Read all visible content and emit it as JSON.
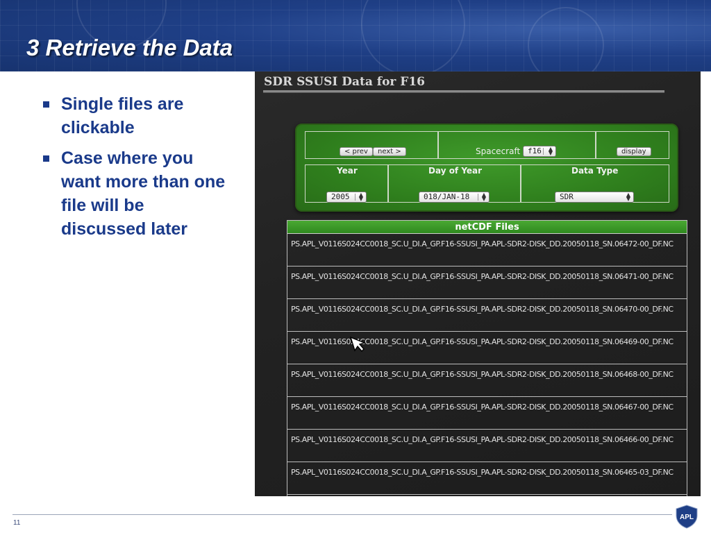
{
  "slide": {
    "title": "3 Retrieve the Data",
    "bullets": [
      "Single files are clickable",
      "Case where you want more than one file will be discussed later"
    ],
    "page_number": "11",
    "logo_text": "APL"
  },
  "app": {
    "title": "SDR SSUSI Data for F16",
    "controls": {
      "prev_label": "< prev",
      "next_label": "next >",
      "spacecraft_label": "Spacecraft",
      "spacecraft_value": "f16",
      "display_label": "display",
      "year_header": "Year",
      "doy_header": "Day of Year",
      "datatype_header": "Data Type",
      "year_value": "2005",
      "doy_value": "018/JAN-18",
      "datatype_value": "SDR"
    },
    "files": {
      "header": "netCDF Files",
      "items": [
        "PS.APL_V0116S024CC0018_SC.U_DI.A_GP.F16-SSUSI_PA.APL-SDR2-DISK_DD.20050118_SN.06472-00_DF.NC",
        "PS.APL_V0116S024CC0018_SC.U_DI.A_GP.F16-SSUSI_PA.APL-SDR2-DISK_DD.20050118_SN.06471-00_DF.NC",
        "PS.APL_V0116S024CC0018_SC.U_DI.A_GP.F16-SSUSI_PA.APL-SDR2-DISK_DD.20050118_SN.06470-00_DF.NC",
        "PS.APL_V0116S024CC0018_SC.U_DI.A_GP.F16-SSUSI_PA.APL-SDR2-DISK_DD.20050118_SN.06469-00_DF.NC",
        "PS.APL_V0116S024CC0018_SC.U_DI.A_GP.F16-SSUSI_PA.APL-SDR2-DISK_DD.20050118_SN.06468-00_DF.NC",
        "PS.APL_V0116S024CC0018_SC.U_DI.A_GP.F16-SSUSI_PA.APL-SDR2-DISK_DD.20050118_SN.06467-00_DF.NC",
        "PS.APL_V0116S024CC0018_SC.U_DI.A_GP.F16-SSUSI_PA.APL-SDR2-DISK_DD.20050118_SN.06466-00_DF.NC",
        "PS.APL_V0116S024CC0018_SC.U_DI.A_GP.F16-SSUSI_PA.APL-SDR2-DISK_DD.20050118_SN.06465-03_DF.NC"
      ]
    }
  },
  "icons": [
    "mouse-pointer-icon",
    "apl-shield-logo-icon"
  ],
  "colors": {
    "header_blue": "#1f3f86",
    "bullet_text": "#1a3a8a",
    "panel_green": "#2f7f1d",
    "panel_dark": "#222222"
  }
}
